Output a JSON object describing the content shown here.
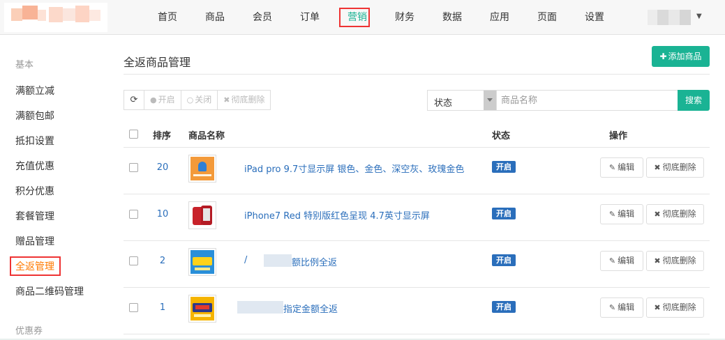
{
  "header": {
    "nav": [
      {
        "label": "首页",
        "name": "nav-home"
      },
      {
        "label": "商品",
        "name": "nav-goods"
      },
      {
        "label": "会员",
        "name": "nav-members"
      },
      {
        "label": "订单",
        "name": "nav-orders"
      },
      {
        "label": "营销",
        "name": "nav-marketing",
        "active": true
      },
      {
        "label": "财务",
        "name": "nav-finance"
      },
      {
        "label": "数据",
        "name": "nav-data"
      },
      {
        "label": "应用",
        "name": "nav-apps"
      },
      {
        "label": "页面",
        "name": "nav-pages"
      },
      {
        "label": "设置",
        "name": "nav-settings"
      }
    ],
    "active_color": "#1ab394"
  },
  "sidebar": {
    "group1": "基本",
    "items": [
      {
        "label": "满额立减"
      },
      {
        "label": "满额包邮"
      },
      {
        "label": "抵扣设置"
      },
      {
        "label": "充值优惠"
      },
      {
        "label": "积分优惠"
      },
      {
        "label": "套餐管理"
      },
      {
        "label": "赠品管理"
      },
      {
        "label": "全返管理",
        "active": true
      },
      {
        "label": "商品二维码管理"
      }
    ],
    "group2": "优惠券"
  },
  "main": {
    "title": "全返商品管理",
    "add_button": "添加商品",
    "toolbar": {
      "enable": "开启",
      "disable": "关闭",
      "delete": "彻底删除"
    },
    "filter": {
      "status_label": "状态",
      "search_placeholder": "商品名称",
      "search_button": "搜索"
    },
    "table": {
      "headers": {
        "sort": "排序",
        "name": "商品名称",
        "status": "状态",
        "actions": "操作"
      },
      "rows": [
        {
          "sort": "20",
          "name": "iPad pro 9.7寸显示屏 银色、金色、深空灰、玫瑰金色",
          "status": "开启",
          "edit": "编辑",
          "delete": "彻底删除"
        },
        {
          "sort": "10",
          "name": "iPhone7 Red 特别版红色呈现 4.7英寸显示屏",
          "status": "开启",
          "edit": "编辑",
          "delete": "彻底删除"
        },
        {
          "sort": "2",
          "name_prefix": "/",
          "name": "额比例全返",
          "status": "开启",
          "edit": "编辑",
          "delete": "彻底删除"
        },
        {
          "sort": "1",
          "name": "指定金额全返",
          "status": "开启",
          "edit": "编辑",
          "delete": "彻底删除"
        }
      ]
    }
  },
  "colors": {
    "primary": "#1ab394",
    "link": "#2a6ebb",
    "sidebar_active": "#ff7a00",
    "highlight_box": "#e33"
  }
}
